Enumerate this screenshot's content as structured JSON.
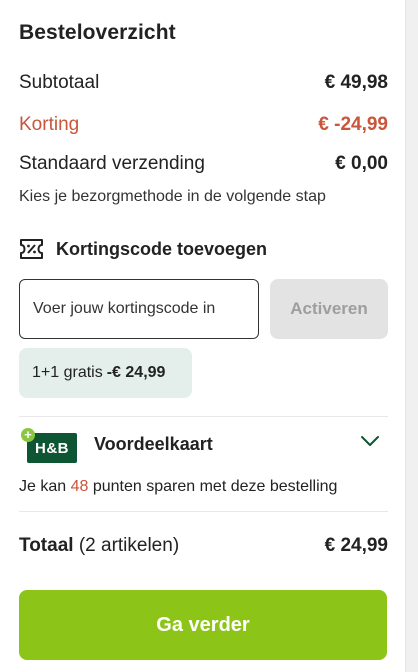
{
  "summary": {
    "title": "Besteloverzicht",
    "subtotal_label": "Subtotaal",
    "subtotal_value": "€ 49,98",
    "discount_label": "Korting",
    "discount_value": "€ -24,99",
    "shipping_label": "Standaard verzending",
    "shipping_value": "€ 0,00",
    "shipping_note": "Kies je bezorgmethode in de volgende stap"
  },
  "coupon": {
    "heading": "Kortingscode toevoegen",
    "placeholder": "Voer jouw kortingscode in",
    "activate_label": "Activeren",
    "applied_label": "1+1 gratis",
    "applied_value": "-€ 24,99"
  },
  "loyalty": {
    "logo_text": "H&B",
    "title": "Voordeelkaart",
    "points_prefix": "Je kan",
    "points_value": "48",
    "points_suffix": "punten sparen met deze bestelling"
  },
  "total": {
    "label": "Totaal",
    "items": "(2 artikelen)",
    "value": "€ 24,99"
  },
  "cta": {
    "label": "Ga verder"
  },
  "colors": {
    "accent_green": "#8cc518",
    "discount_red": "#c9553b",
    "brand_green": "#0e5533",
    "applied_bg": "#e4efec"
  },
  "icons": {
    "coupon": "ticket-percent-icon",
    "chevron": "chevron-down-icon"
  }
}
